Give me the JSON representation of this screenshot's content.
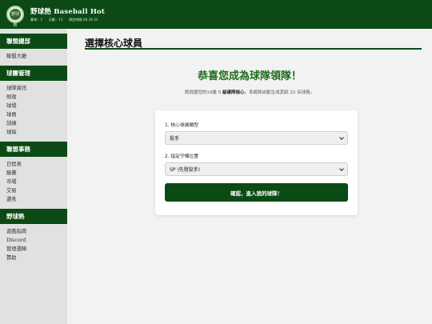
{
  "header": {
    "logo_text": "野球熱",
    "title": "野球熱 Baseball Hot",
    "season": "賽季：1",
    "day": "天數：13",
    "server_time": "預定時間 08.34.33"
  },
  "sidebar": {
    "sections": [
      {
        "title": "聯盟總部",
        "items": [
          "聯盟大廳"
        ]
      },
      {
        "title": "球團管理",
        "items": [
          "球隊資訊",
          "財政",
          "球場",
          "球員",
          "訓練",
          "球探"
        ]
      },
      {
        "title": "聯盟事務",
        "items": [
          "日程表",
          "聯賽",
          "市場",
          "交易",
          "選秀"
        ]
      },
      {
        "title": "野球熱",
        "items": [
          "遊戲指南",
          "Discord",
          "管理選陣",
          "贊助"
        ]
      }
    ]
  },
  "main": {
    "page_title": "選擇核心球員",
    "congrats": "恭喜您成為球隊領隊！",
    "instruction_pre": "請挑選您的18歲 S ",
    "instruction_bold": "級建隊核心",
    "instruction_post": "。系統將自動生成其餘 25 名球員。",
    "form": {
      "type_label": "1. 核心球員類型",
      "type_value": "投手",
      "position_label": "2. 指定守備位置",
      "position_value": "SP (先發投手)",
      "confirm_label": "確認，進入我的球隊！"
    }
  },
  "colors": {
    "primary": "#0b4a14",
    "accent_text": "#1d6b1c",
    "sidebar_bg": "#e1e1e1",
    "page_bg": "#f2f2f2"
  }
}
